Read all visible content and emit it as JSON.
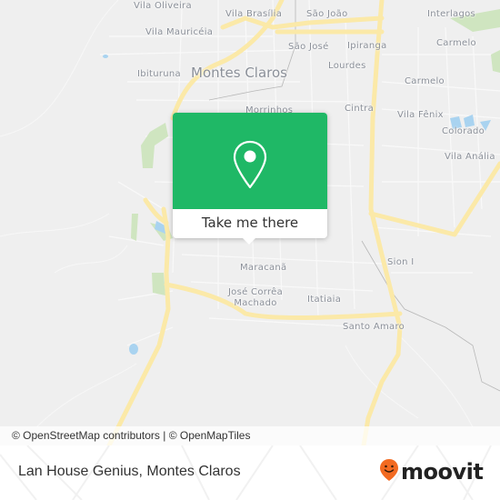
{
  "map": {
    "city_label": "Montes Claros",
    "places": [
      {
        "name": "Vila Oliveira"
      },
      {
        "name": "Vila Brasília"
      },
      {
        "name": "São João"
      },
      {
        "name": "Interlagos"
      },
      {
        "name": "Vila Mauricéia"
      },
      {
        "name": "São José"
      },
      {
        "name": "Ipiranga"
      },
      {
        "name": "Carmelo"
      },
      {
        "name": "Ibituruna"
      },
      {
        "name": "Lourdes"
      },
      {
        "name": "Carmelo"
      },
      {
        "name": "Morrinhos"
      },
      {
        "name": "Cintra"
      },
      {
        "name": "Vila Fênix"
      },
      {
        "name": "Colorado"
      },
      {
        "name": "Vila Anália"
      },
      {
        "name": "Sion I"
      },
      {
        "name": "Maracanã"
      },
      {
        "name": "José Corrêa Machado"
      },
      {
        "name": "Itatiaia"
      },
      {
        "name": "Santo Amaro"
      }
    ],
    "colors": {
      "background": "#efefef",
      "road_major": "#fbe9a8",
      "road_minor": "#ffffff",
      "park": "#cfe5c0",
      "water": "#a9d3f0",
      "label": "#8a8f98"
    }
  },
  "popup": {
    "icon": "map-pin-icon",
    "action_label": "Take me there",
    "color": "#1fb866"
  },
  "attribution": {
    "text": "© OpenStreetMap contributors | © OpenMapTiles"
  },
  "footer": {
    "title": "Lan House Genius, Montes Claros",
    "brand": "moovit",
    "brand_color": "#f26a21"
  }
}
